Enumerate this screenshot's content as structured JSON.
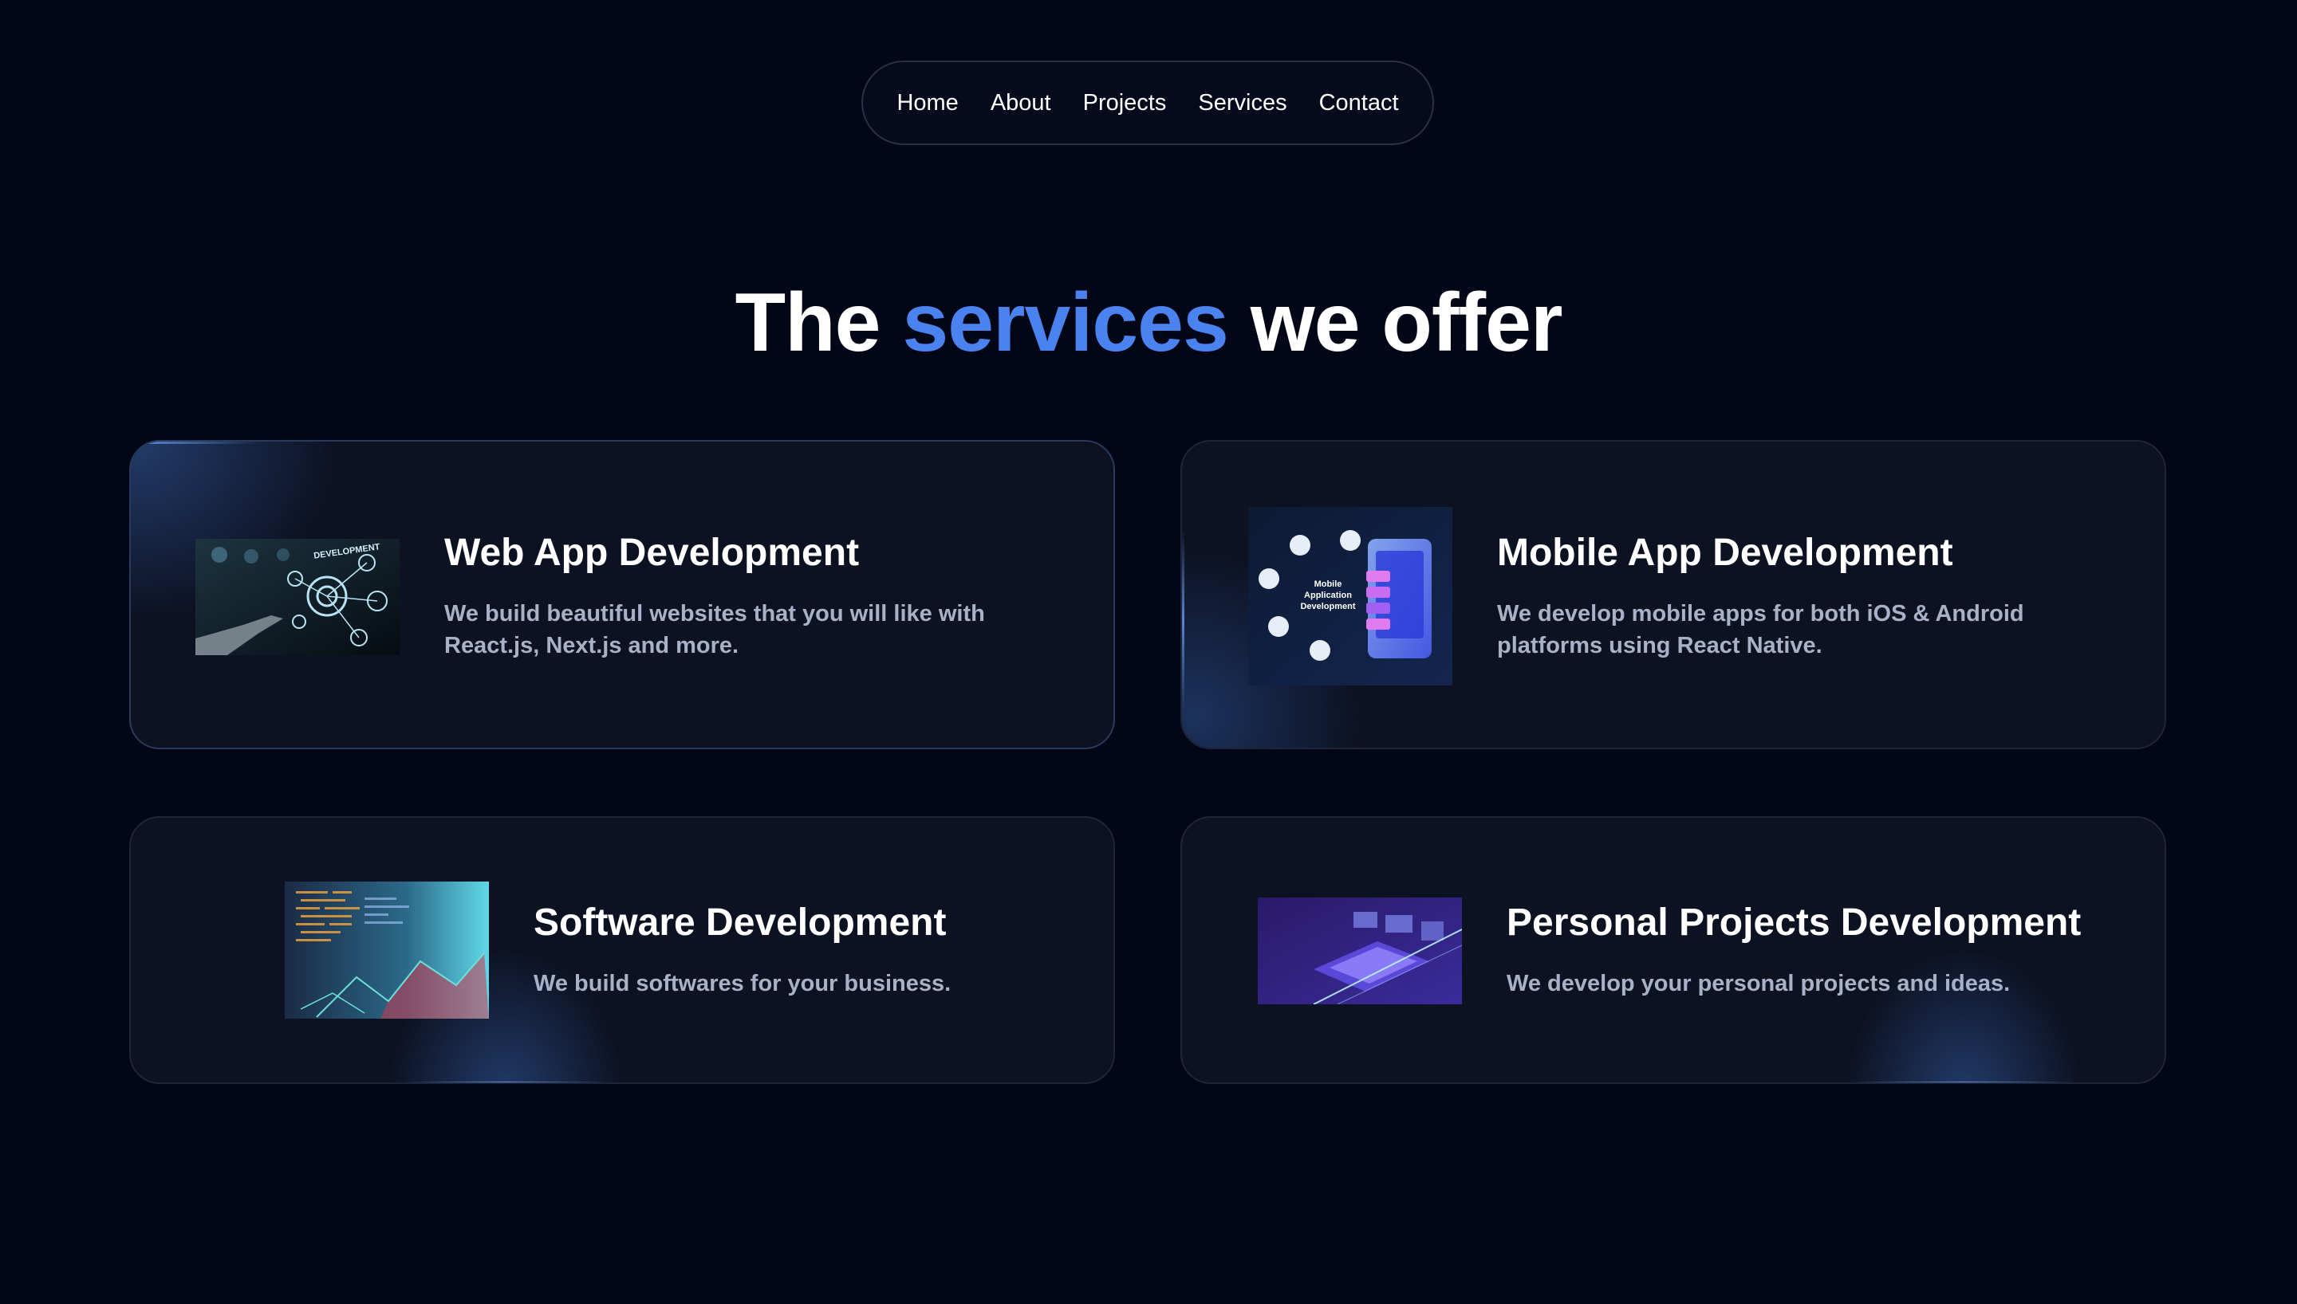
{
  "nav": {
    "items": [
      "Home",
      "About",
      "Projects",
      "Services",
      "Contact"
    ]
  },
  "headline": {
    "prefix": "The",
    "accent": "services",
    "suffix": "we offer"
  },
  "services": [
    {
      "title": "Web App Development",
      "description": "We build beautiful websites that you will like with React.js, Next.js and more.",
      "image_text": "DEVELOPMENT"
    },
    {
      "title": "Mobile App Development",
      "description": "We develop mobile apps for both iOS & Android platforms using React Native.",
      "image_text": "Mobile Application Development"
    },
    {
      "title": "Software Development",
      "description": "We build softwares for your business."
    },
    {
      "title": "Personal Projects Development",
      "description": "We develop your personal projects and ideas."
    }
  ],
  "colors": {
    "background": "#030617",
    "accent": "#4a82f0",
    "card": "#0d1223",
    "text_muted": "#a9b1c7"
  }
}
